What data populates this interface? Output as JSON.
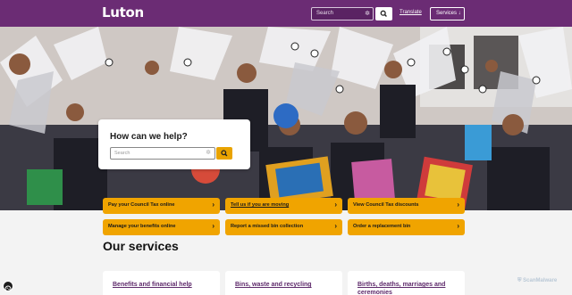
{
  "header": {
    "logo": "Luton",
    "search_placeholder": "Search",
    "translate_label": "Translate",
    "services_label": "Services ↓"
  },
  "help": {
    "title": "How can we help?",
    "search_placeholder": "Search"
  },
  "quick_links": [
    {
      "label": "Pay your Council Tax online"
    },
    {
      "label": "Tell us if you are moving"
    },
    {
      "label": "View Council Tax discounts"
    },
    {
      "label": "Manage your benefits online"
    },
    {
      "label": "Report a missed bin collection"
    },
    {
      "label": "Order a replacement bin"
    }
  ],
  "services": {
    "title": "Our services",
    "cards": [
      {
        "label": "Benefits and financial help"
      },
      {
        "label": "Bins, waste and recycling"
      },
      {
        "label": "Births, deaths, marriages and ceremonies"
      }
    ]
  },
  "badge": {
    "label": "ScanMalware"
  },
  "colors": {
    "brand_purple": "#6b2c74",
    "accent_amber": "#f0a400",
    "link_purple": "#5e2a6b"
  },
  "icons": {
    "quick_link_arrow": "›",
    "search": "search-icon",
    "gear": "gear-icon"
  }
}
